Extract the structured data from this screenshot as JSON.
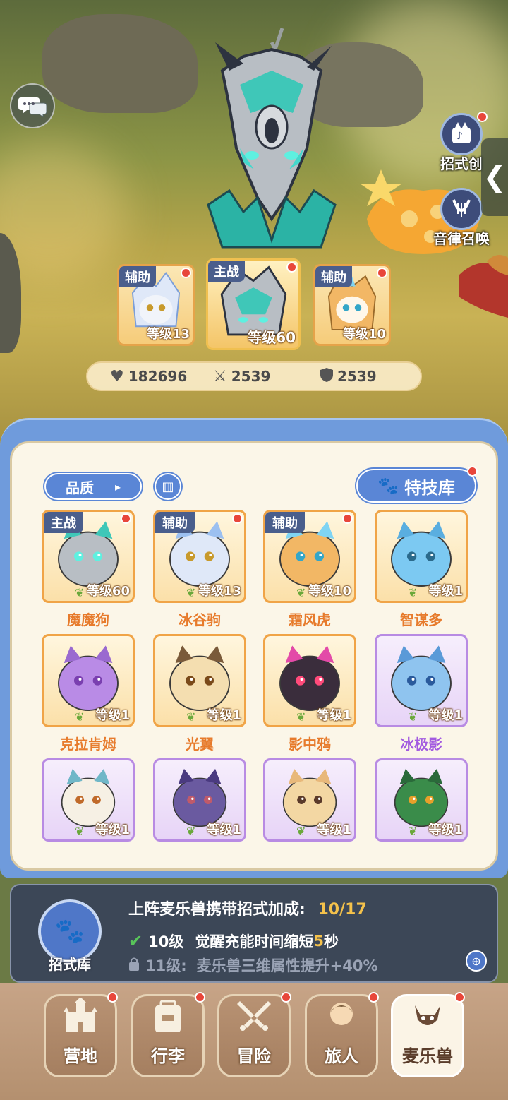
{
  "side_menu": {
    "skill_create_label": "招式创",
    "melody_summon_label": "音律召唤"
  },
  "team": {
    "slots": [
      {
        "tag": "辅助",
        "level": "等级13"
      },
      {
        "tag": "主战",
        "level": "等级60"
      },
      {
        "tag": "辅助",
        "level": "等级10"
      }
    ]
  },
  "stats": {
    "hp": "182696",
    "attack": "2539",
    "defense": "2539"
  },
  "panel": {
    "sort_label": "品质",
    "skill_library_label": "特技库",
    "pets": [
      {
        "name": "魔魔狗",
        "level": "等级60",
        "tag": "主战",
        "rarity": "orange"
      },
      {
        "name": "冰谷驹",
        "level": "等级13",
        "tag": "辅助",
        "rarity": "orange"
      },
      {
        "name": "霜风虎",
        "level": "等级10",
        "tag": "辅助",
        "rarity": "orange"
      },
      {
        "name": "智谋多",
        "level": "等级1",
        "tag": "",
        "rarity": "orange"
      },
      {
        "name": "克拉肯姆",
        "level": "等级1",
        "tag": "",
        "rarity": "orange"
      },
      {
        "name": "光翼",
        "level": "等级1",
        "tag": "",
        "rarity": "orange"
      },
      {
        "name": "影中鸦",
        "level": "等级1",
        "tag": "",
        "rarity": "orange"
      },
      {
        "name": "冰极影",
        "level": "等级1",
        "tag": "",
        "rarity": "purple"
      },
      {
        "name": "",
        "level": "等级1",
        "tag": "",
        "rarity": "purple"
      },
      {
        "name": "",
        "level": "等级1",
        "tag": "",
        "rarity": "purple"
      },
      {
        "name": "",
        "level": "等级1",
        "tag": "",
        "rarity": "purple"
      },
      {
        "name": "",
        "level": "等级1",
        "tag": "",
        "rarity": "purple"
      }
    ]
  },
  "bonus": {
    "library_label": "招式库",
    "title": "上阵麦乐兽携带招式加成:",
    "progress": "10/17",
    "row1_level": "10级",
    "row1_text_a": "觉醒充能时间缩短",
    "row1_highlight": "5",
    "row1_text_b": "秒",
    "row2_level": "11级:",
    "row2_text": "麦乐兽三维属性提升+40%"
  },
  "nav": {
    "items": [
      {
        "label": "营地",
        "icon": "castle-icon"
      },
      {
        "label": "行李",
        "icon": "bag-icon"
      },
      {
        "label": "冒险",
        "icon": "swords-icon"
      },
      {
        "label": "旅人",
        "icon": "traveler-icon"
      },
      {
        "label": "麦乐兽",
        "icon": "pet-icon"
      }
    ]
  },
  "colors": {
    "accent_blue": "#5a86d6",
    "panel_cream": "#fbf6e8",
    "orange_text": "#e77b2c",
    "purple_text": "#a35be0",
    "progress_yellow": "#f5c24b"
  }
}
